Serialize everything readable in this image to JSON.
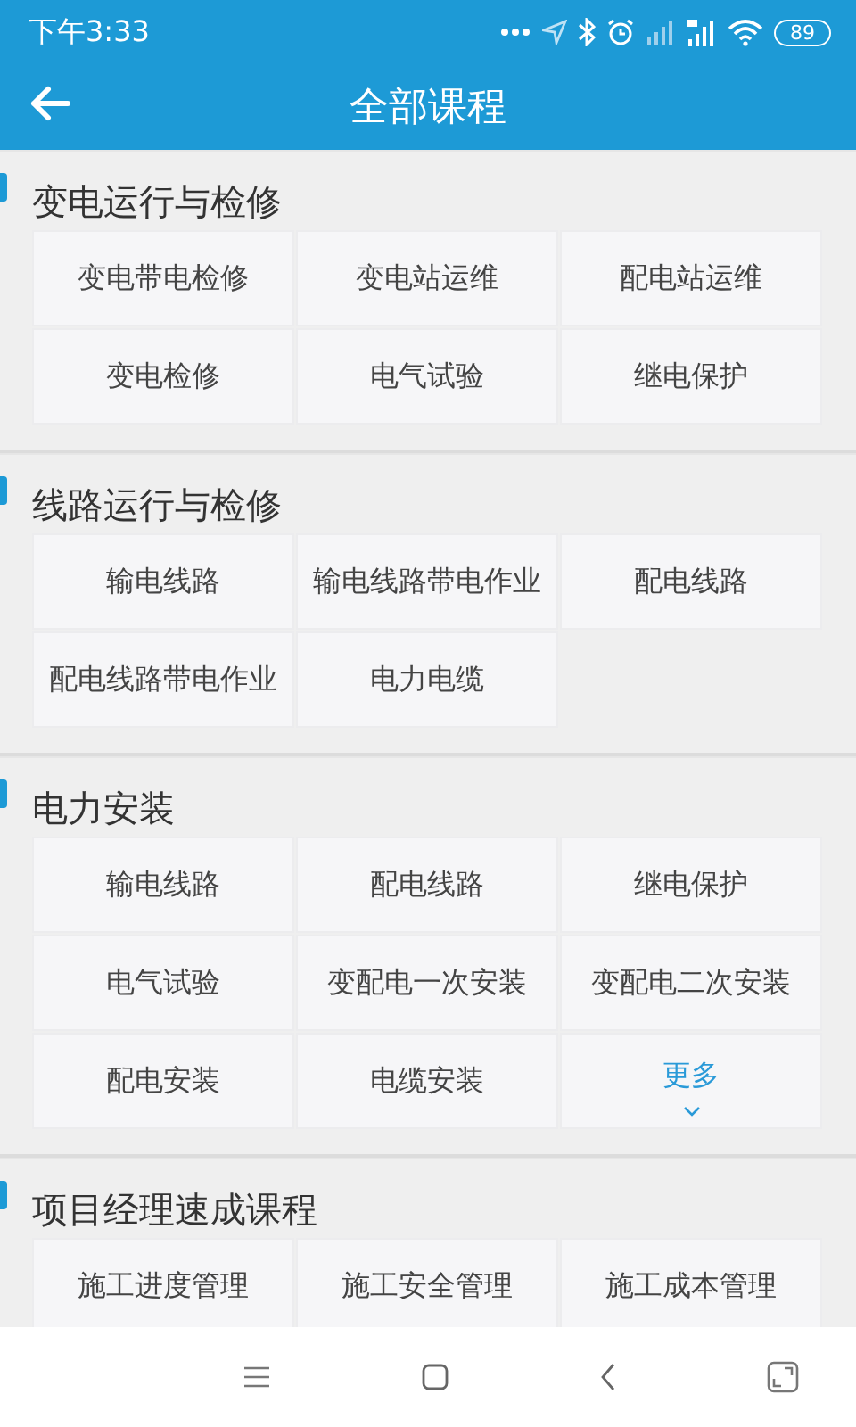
{
  "status_bar": {
    "time": "下午3:33",
    "battery": "89"
  },
  "header": {
    "title": "全部课程"
  },
  "sections": [
    {
      "title": "变电运行与检修",
      "items": [
        {
          "label": "变电带电检修",
          "kind": "course"
        },
        {
          "label": "变电站运维",
          "kind": "course"
        },
        {
          "label": "配电站运维",
          "kind": "course"
        },
        {
          "label": "变电检修",
          "kind": "course"
        },
        {
          "label": "电气试验",
          "kind": "course"
        },
        {
          "label": "继电保护",
          "kind": "course"
        }
      ]
    },
    {
      "title": "线路运行与检修",
      "items": [
        {
          "label": "输电线路",
          "kind": "course"
        },
        {
          "label": "输电线路带电作业",
          "kind": "course"
        },
        {
          "label": "配电线路",
          "kind": "course"
        },
        {
          "label": "配电线路带电作业",
          "kind": "course"
        },
        {
          "label": "电力电缆",
          "kind": "course"
        }
      ]
    },
    {
      "title": "电力安装",
      "items": [
        {
          "label": "输电线路",
          "kind": "course"
        },
        {
          "label": "配电线路",
          "kind": "course"
        },
        {
          "label": "继电保护",
          "kind": "course"
        },
        {
          "label": "电气试验",
          "kind": "course"
        },
        {
          "label": "变配电一次安装",
          "kind": "course"
        },
        {
          "label": "变配电二次安装",
          "kind": "course"
        },
        {
          "label": "配电安装",
          "kind": "course"
        },
        {
          "label": "电缆安装",
          "kind": "course"
        },
        {
          "label": "更多",
          "kind": "more"
        }
      ]
    },
    {
      "title": "项目经理速成课程",
      "items": [
        {
          "label": "施工进度管理",
          "kind": "course"
        },
        {
          "label": "施工安全管理",
          "kind": "course"
        },
        {
          "label": "施工成本管理",
          "kind": "course"
        }
      ]
    }
  ]
}
